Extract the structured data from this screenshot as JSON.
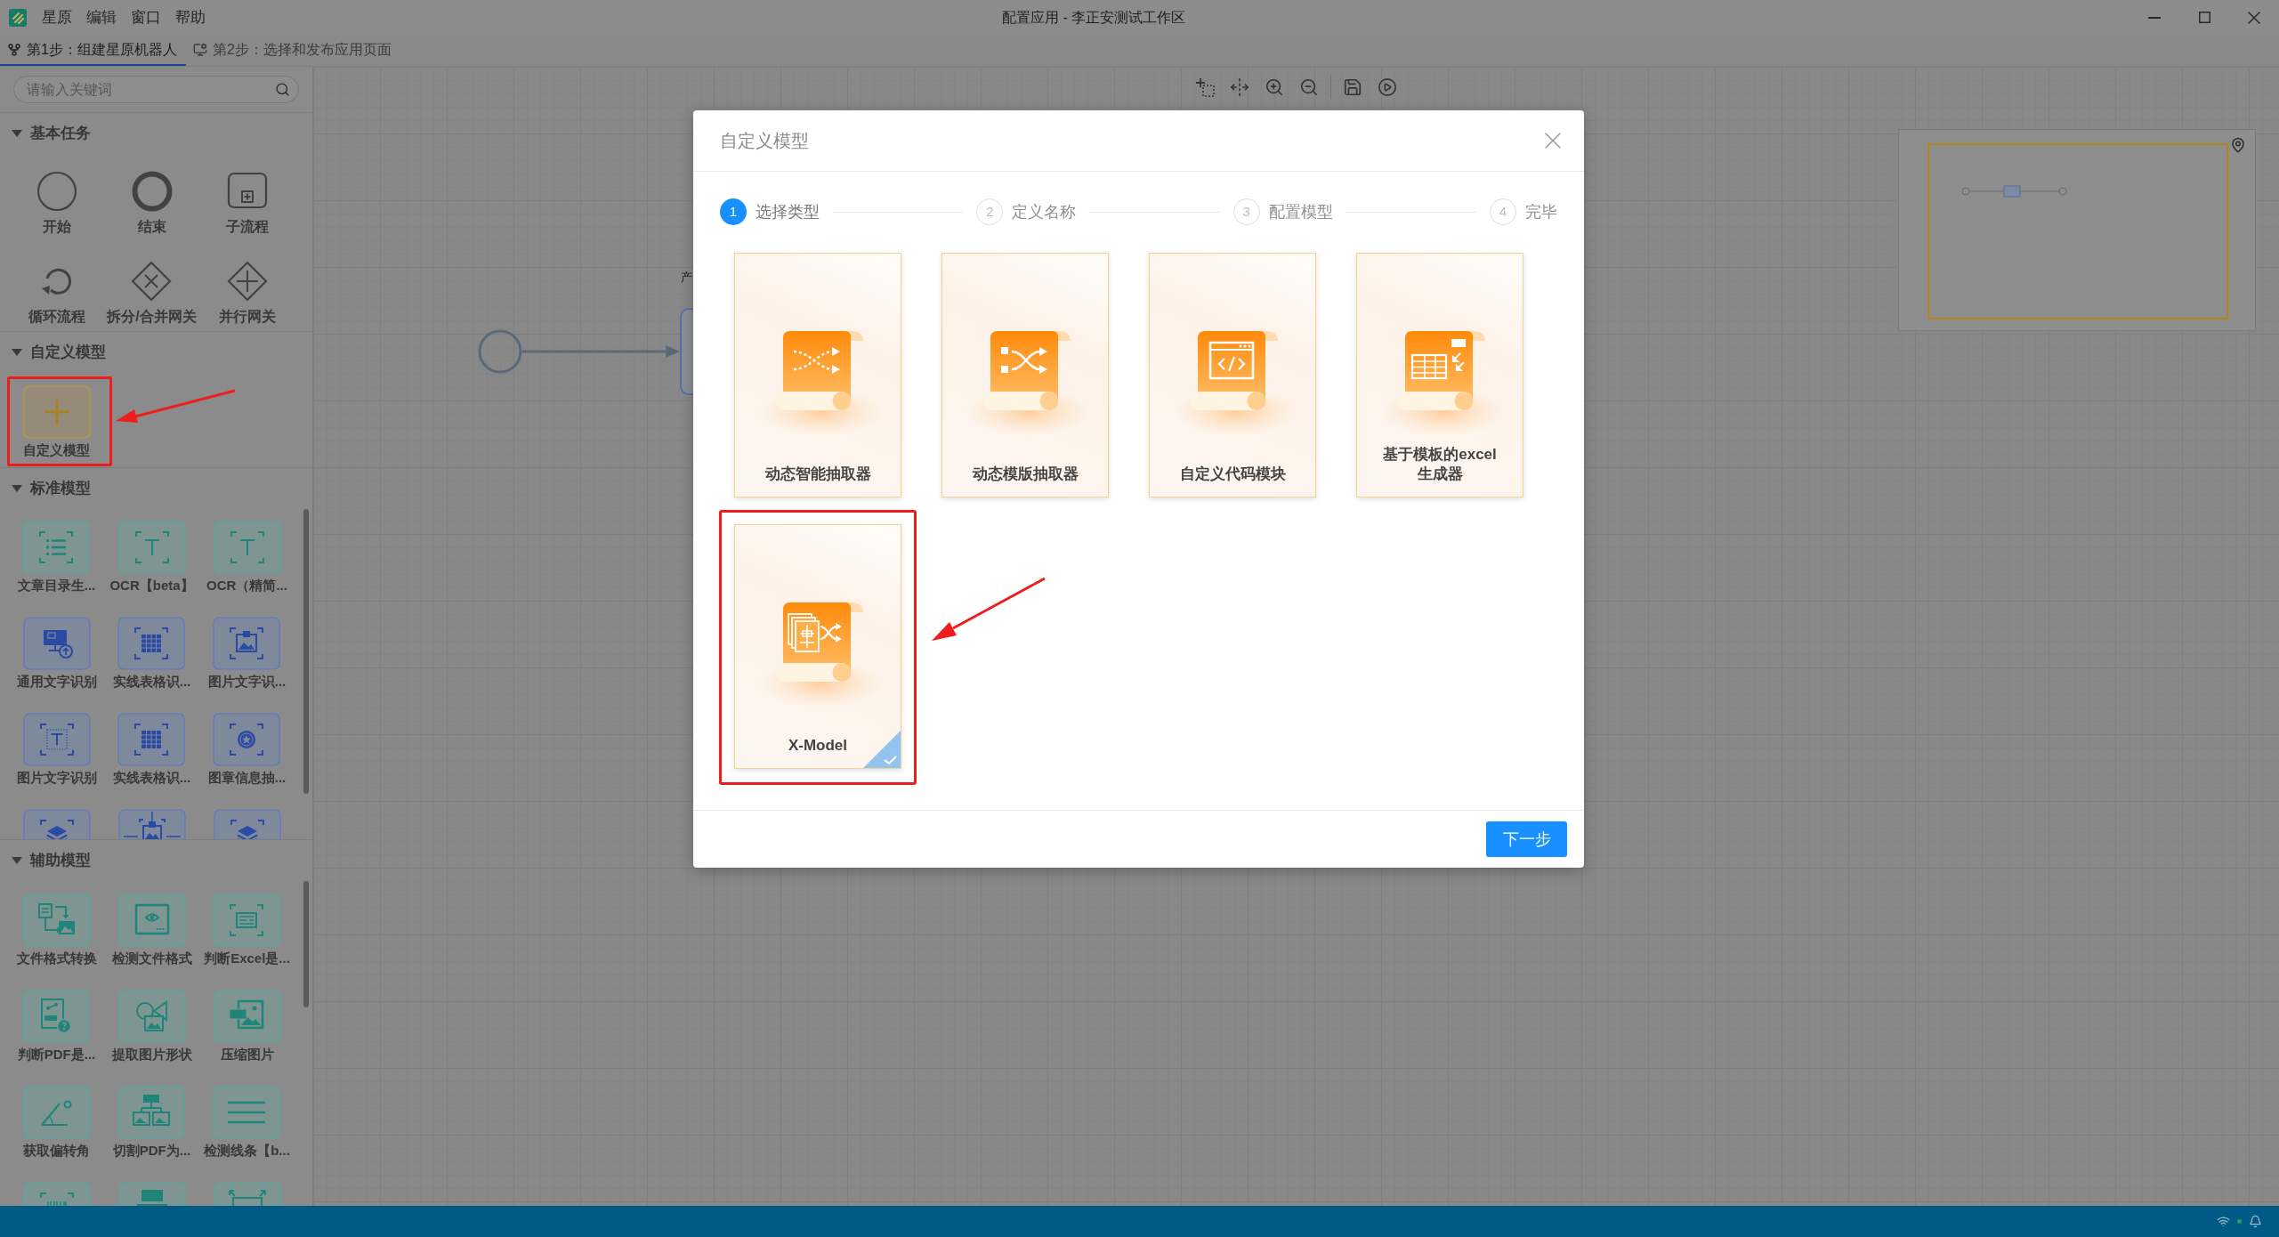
{
  "window": {
    "title": "配置应用 - 李正安测试工作区"
  },
  "menu": [
    {
      "label": "星原"
    },
    {
      "label": "编辑"
    },
    {
      "label": "窗口"
    },
    {
      "label": "帮助"
    }
  ],
  "tabs": [
    {
      "label": "第1步：组建星原机器人",
      "selected": true
    },
    {
      "label": "第2步：选择和发布应用页面",
      "selected": false
    }
  ],
  "sidebar": {
    "search": {
      "placeholder": "请输入关键词"
    },
    "sections": [
      {
        "title": "基本任务",
        "expanded": true,
        "items": [
          {
            "kind": "shape",
            "label": "开始"
          },
          {
            "kind": "shape",
            "label": "结束"
          },
          {
            "kind": "shape",
            "label": "子流程"
          },
          {
            "kind": "shape",
            "label": "循环流程"
          },
          {
            "kind": "shape",
            "label": "拆分/合并网关"
          },
          {
            "kind": "shape",
            "label": "并行网关"
          }
        ]
      },
      {
        "title": "自定义模型",
        "expanded": true,
        "items": [
          {
            "kind": "add",
            "label": "自定义模型",
            "highlighted": true
          }
        ]
      },
      {
        "title": "标准模型",
        "expanded": true,
        "items": [
          {
            "kind": "tile",
            "label": "文章目录生..."
          },
          {
            "kind": "tile",
            "label": "OCR【beta】"
          },
          {
            "kind": "tile",
            "label": "OCR（精简..."
          },
          {
            "kind": "tile",
            "label": "通用文字识别"
          },
          {
            "kind": "tile",
            "label": "实线表格识..."
          },
          {
            "kind": "tile",
            "label": "图片文字识..."
          },
          {
            "kind": "tile",
            "label": "图片文字识别"
          },
          {
            "kind": "tile",
            "label": "实线表格识..."
          },
          {
            "kind": "tile",
            "label": "图章信息抽..."
          },
          {
            "kind": "tile"
          },
          {
            "kind": "tile"
          },
          {
            "kind": "tile"
          }
        ]
      },
      {
        "title": "辅助模型",
        "expanded": true,
        "items": [
          {
            "kind": "tile",
            "label": "文件格式转换"
          },
          {
            "kind": "tile",
            "label": "检测文件格式"
          },
          {
            "kind": "tile",
            "label": "判断Excel是..."
          },
          {
            "kind": "tile",
            "label": "判断PDF是..."
          },
          {
            "kind": "tile",
            "label": "提取图片形状"
          },
          {
            "kind": "tile",
            "label": "压缩图片"
          },
          {
            "kind": "tile",
            "label": "获取偏转角"
          },
          {
            "kind": "tile",
            "label": "切割PDF为..."
          },
          {
            "kind": "tile",
            "label": "检测线条【b..."
          },
          {
            "kind": "tile"
          },
          {
            "kind": "tile"
          },
          {
            "kind": "tile"
          }
        ]
      }
    ]
  },
  "canvas": {
    "node_caption": "产"
  },
  "dialog": {
    "title": "自定义模型",
    "steps": [
      {
        "number": "1",
        "label": "选择类型",
        "current": true
      },
      {
        "number": "2",
        "label": "定义名称",
        "current": false
      },
      {
        "number": "3",
        "label": "配置模型",
        "current": false
      },
      {
        "number": "4",
        "label": "完毕",
        "current": false
      }
    ],
    "cards": [
      {
        "label": "动态智能抽取器",
        "selected": false,
        "highlighted": false
      },
      {
        "label": "动态模版抽取器",
        "selected": false,
        "highlighted": false
      },
      {
        "label": "自定义代码模块",
        "selected": false,
        "highlighted": false
      },
      {
        "label": "基于模板的excel生成器",
        "selected": false,
        "highlighted": false
      },
      {
        "label": "X-Model",
        "selected": true,
        "highlighted": true
      }
    ],
    "next_button": {
      "label": "下一步"
    }
  }
}
